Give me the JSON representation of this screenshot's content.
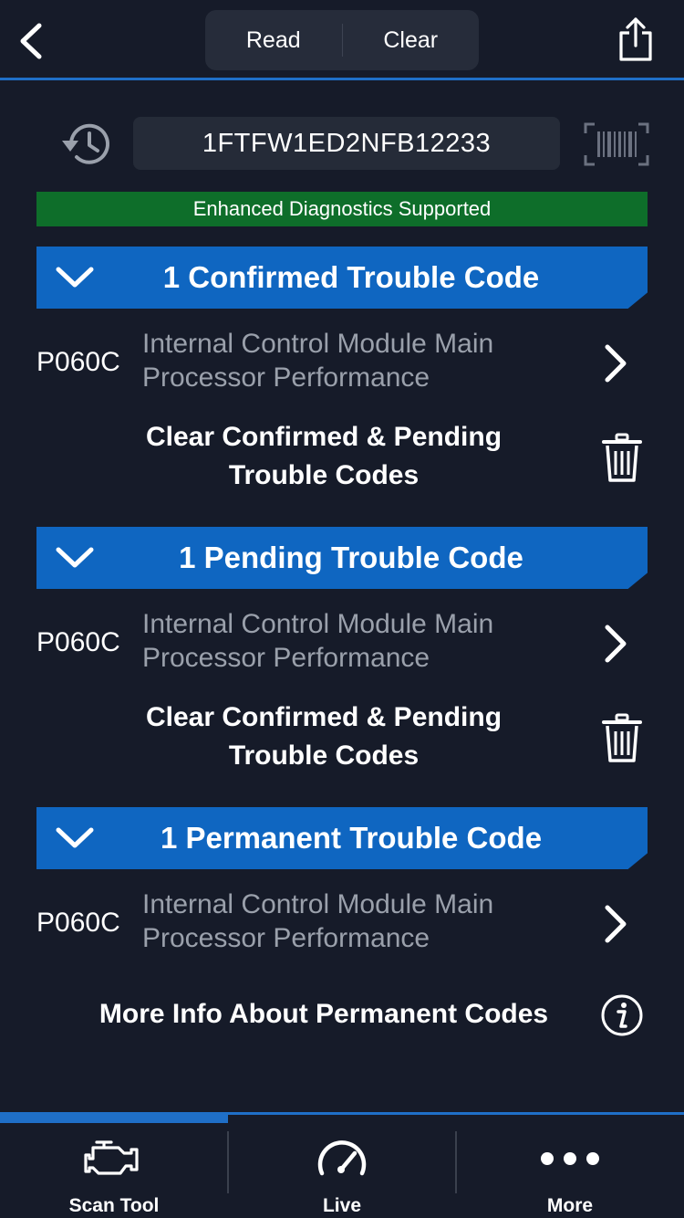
{
  "header": {
    "segments": [
      "Read",
      "Clear"
    ]
  },
  "vin": {
    "value": "1FTFW1ED2NFB12233"
  },
  "banner": {
    "text": "Enhanced Diagnostics Supported",
    "color": "#0e6e2a"
  },
  "sections": [
    {
      "title": "1 Confirmed Trouble Code",
      "codes": [
        {
          "code": "P060C",
          "desc_line1": "Internal Control Module Main",
          "desc_line2": "Processor Performance"
        }
      ],
      "clear_label_line1": "Clear Confirmed & Pending",
      "clear_label_line2": "Trouble Codes"
    },
    {
      "title": "1 Pending Trouble Code",
      "codes": [
        {
          "code": "P060C",
          "desc_line1": "Internal Control Module Main",
          "desc_line2": "Processor Performance"
        }
      ],
      "clear_label_line1": "Clear Confirmed & Pending",
      "clear_label_line2": "Trouble Codes"
    },
    {
      "title": "1 Permanent Trouble Code",
      "codes": [
        {
          "code": "P060C",
          "desc_line1": "Internal Control Module Main",
          "desc_line2": "Processor Performance"
        }
      ]
    }
  ],
  "info": {
    "label": "More Info About Permanent Codes"
  },
  "tabbar": {
    "tabs": [
      {
        "label": "Scan Tool",
        "icon": "engine-icon",
        "active": true
      },
      {
        "label": "Live",
        "icon": "gauge-icon",
        "active": false
      },
      {
        "label": "More",
        "icon": "more-dots-icon",
        "active": false
      }
    ]
  },
  "colors": {
    "background": "#161b29",
    "accent": "#1f6fc7",
    "section_header": "#0f66c1",
    "description_text": "#9aa0ab"
  }
}
